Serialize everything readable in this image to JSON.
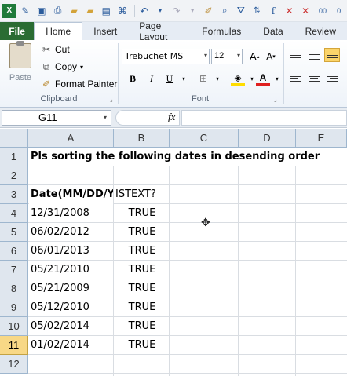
{
  "tabs": {
    "file": "File",
    "items": [
      "Home",
      "Insert",
      "Page Layout",
      "Formulas",
      "Data",
      "Review"
    ]
  },
  "ribbon": {
    "clipboard": {
      "paste": "Paste",
      "cut": "Cut",
      "copy": "Copy",
      "format_painter": "Format Painter",
      "label": "Clipboard"
    },
    "font": {
      "name": "Trebuchet MS",
      "size": "12",
      "label": "Font"
    }
  },
  "formula_bar": {
    "name_box": "G11",
    "fx": "fx",
    "content": ""
  },
  "columns": [
    "A",
    "B",
    "C",
    "D",
    "E"
  ],
  "rows": [
    "1",
    "2",
    "3",
    "4",
    "5",
    "6",
    "7",
    "8",
    "9",
    "10",
    "11",
    "12"
  ],
  "selected_row": "11",
  "cells": {
    "title": "Pls sorting the following dates in desending order",
    "header_a": "Date(MM/DD/Y",
    "header_b": "ISTEXT?",
    "dates": [
      "12/31/2008",
      "06/02/2012",
      "06/01/2013",
      "05/21/2010",
      "05/21/2009",
      "05/12/2010",
      "05/02/2014",
      "01/02/2014"
    ],
    "istext": [
      "TRUE",
      "TRUE",
      "TRUE",
      "TRUE",
      "TRUE",
      "TRUE",
      "TRUE",
      "TRUE"
    ]
  },
  "colors": {
    "file_tab": "#2a6c33",
    "selected_row_header": "#f8d886"
  }
}
